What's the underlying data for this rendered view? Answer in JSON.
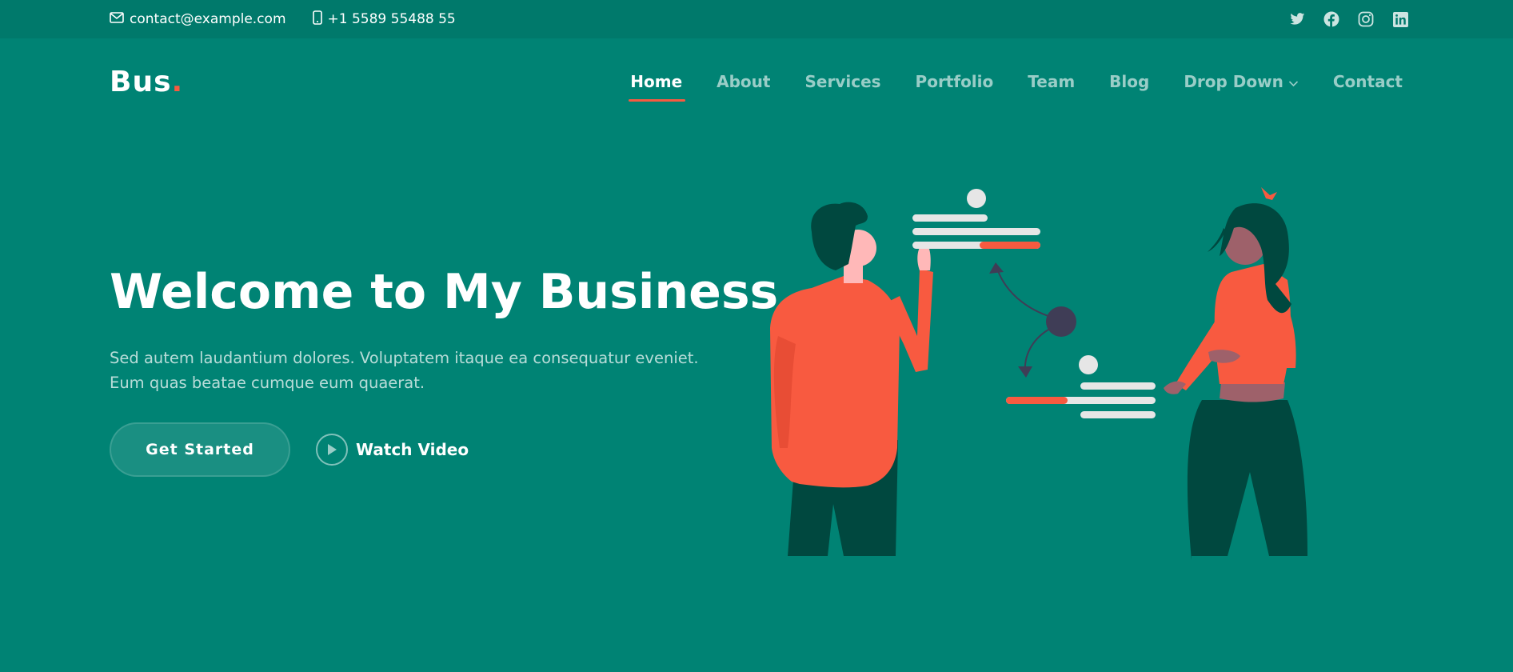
{
  "topbar": {
    "email": "contact@example.com",
    "phone": "+1 5589 55488 55",
    "socials": [
      "twitter-icon",
      "facebook-icon",
      "instagram-icon",
      "linkedin-icon"
    ]
  },
  "header": {
    "logo_text": "Bus",
    "logo_dot": ".",
    "nav": [
      {
        "label": "Home",
        "active": true
      },
      {
        "label": "About"
      },
      {
        "label": "Services"
      },
      {
        "label": "Portfolio"
      },
      {
        "label": "Team"
      },
      {
        "label": "Blog"
      },
      {
        "label": "Drop Down",
        "has_dropdown": true
      },
      {
        "label": "Contact"
      }
    ]
  },
  "hero": {
    "title": "Welcome to My Business",
    "text": "Sed autem laudantium dolores. Voluptatem itaque ea consequatur eveniet. Eum quas beatae cumque eum quaerat.",
    "primary_button": "Get Started",
    "video_button": "Watch Video"
  },
  "colors": {
    "background": "#008374",
    "topbar": "#00796b",
    "accent": "#f85a40",
    "dark_green": "#00483f"
  }
}
